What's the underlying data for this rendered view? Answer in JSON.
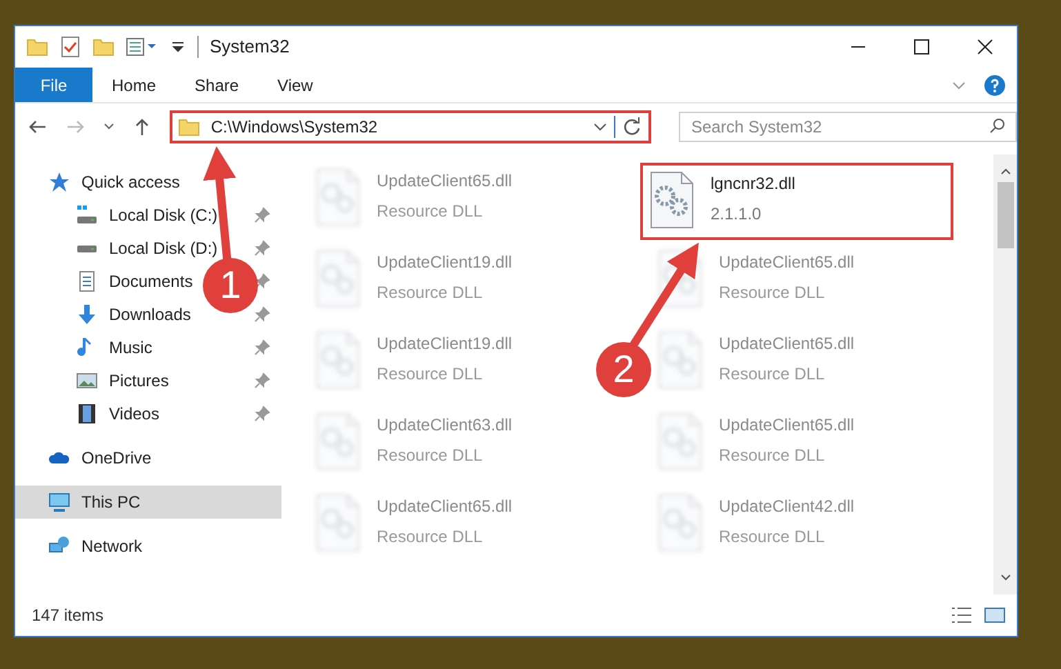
{
  "window": {
    "title": "System32"
  },
  "ribbon_tabs": [
    {
      "label": "File",
      "selected": true
    },
    {
      "label": "Home",
      "selected": false
    },
    {
      "label": "Share",
      "selected": false
    },
    {
      "label": "View",
      "selected": false
    }
  ],
  "address": {
    "path": "C:\\Windows\\System32"
  },
  "search": {
    "placeholder": "Search System32"
  },
  "sidebar": {
    "items": [
      {
        "label": "Quick access",
        "kind": "star",
        "selected": false,
        "children": [
          {
            "label": "Local Disk (C:)",
            "kind": "windisk",
            "pinned": true,
            "selected": false
          },
          {
            "label": "Local Disk (D:)",
            "kind": "disk",
            "pinned": true,
            "selected": false
          },
          {
            "label": "Documents",
            "kind": "doc",
            "pinned": true,
            "selected": false
          },
          {
            "label": "Downloads",
            "kind": "download",
            "pinned": true,
            "selected": false
          },
          {
            "label": "Music",
            "kind": "music",
            "pinned": true,
            "selected": false
          },
          {
            "label": "Pictures",
            "kind": "picture",
            "pinned": true,
            "selected": false
          },
          {
            "label": "Videos",
            "kind": "video",
            "pinned": true,
            "selected": false
          }
        ]
      },
      {
        "label": "OneDrive",
        "kind": "cloud",
        "selected": false
      },
      {
        "label": "This PC",
        "kind": "pc",
        "selected": true
      },
      {
        "label": "Network",
        "kind": "network",
        "selected": false
      }
    ]
  },
  "files": [
    {
      "name": "UpdateClient65.dll",
      "detail": "Resource DLL",
      "blurred": true
    },
    {
      "name": "lgncnr32.dll",
      "detail": "2.1.1.0",
      "blurred": false
    },
    {
      "name": "UpdateClient19.dll",
      "detail": "Resource DLL",
      "blurred": true
    },
    {
      "name": "UpdateClient65.dll",
      "detail": "Resource DLL",
      "blurred": true
    },
    {
      "name": "UpdateClient19.dll",
      "detail": "Resource DLL",
      "blurred": true
    },
    {
      "name": "UpdateClient65.dll",
      "detail": "Resource DLL",
      "blurred": true
    },
    {
      "name": "UpdateClient63.dll",
      "detail": "Resource DLL",
      "blurred": true
    },
    {
      "name": "UpdateClient65.dll",
      "detail": "Resource DLL",
      "blurred": true
    },
    {
      "name": "UpdateClient65.dll",
      "detail": "Resource DLL",
      "blurred": true
    },
    {
      "name": "UpdateClient42.dll",
      "detail": "Resource DLL",
      "blurred": true
    }
  ],
  "status_bar": {
    "count": "147 items"
  },
  "annotations": [
    {
      "number": "1"
    },
    {
      "number": "2"
    }
  ]
}
